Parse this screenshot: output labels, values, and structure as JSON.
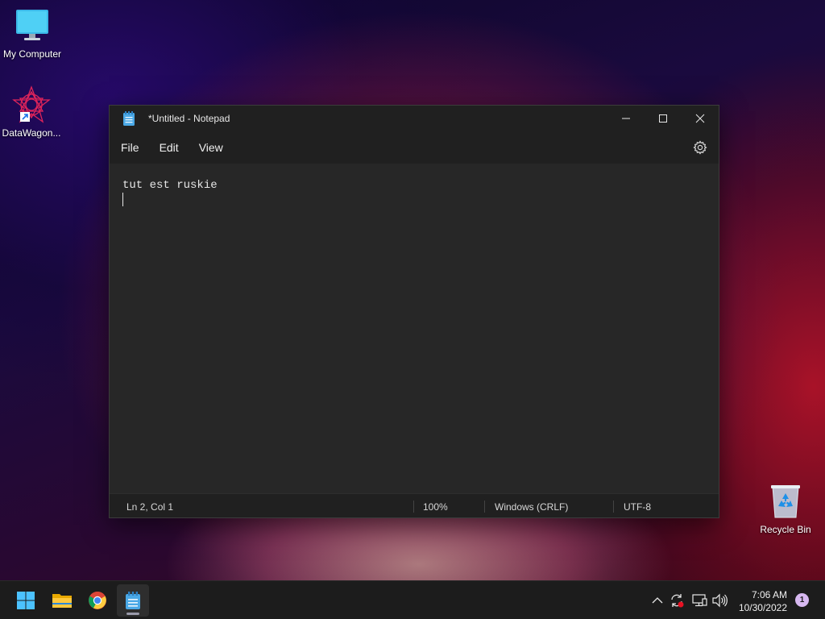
{
  "desktop": {
    "icons": [
      {
        "label": "My Computer"
      },
      {
        "label": "DataWagon..."
      },
      {
        "label": "Recycle Bin"
      }
    ]
  },
  "window": {
    "title": "*Untitled - Notepad",
    "menu": [
      "File",
      "Edit",
      "View"
    ],
    "content": {
      "lines": [
        "tut est ruskie",
        ""
      ]
    },
    "status": {
      "position": "Ln 2, Col 1",
      "zoom": "100%",
      "line_ending": "Windows (CRLF)",
      "encoding": "UTF-8"
    },
    "icons": {
      "app": "notepad-icon",
      "settings": "gear-icon",
      "minimize": "minimize-icon",
      "maximize": "maximize-icon",
      "close": "close-icon"
    }
  },
  "taskbar": {
    "apps": [
      "start-icon",
      "file-explorer-icon",
      "chrome-icon",
      "notepad-icon"
    ],
    "tray": [
      "chevron-up-icon",
      "sync-icon",
      "network-icon",
      "volume-icon"
    ],
    "time": "7:06 AM",
    "date": "10/30/2022",
    "notification_count": "1"
  },
  "colors": {
    "window_bg": "#272727",
    "titlebar_bg": "#202020",
    "taskbar_bg": "#1c1c1c",
    "accent": "#0078d4"
  }
}
